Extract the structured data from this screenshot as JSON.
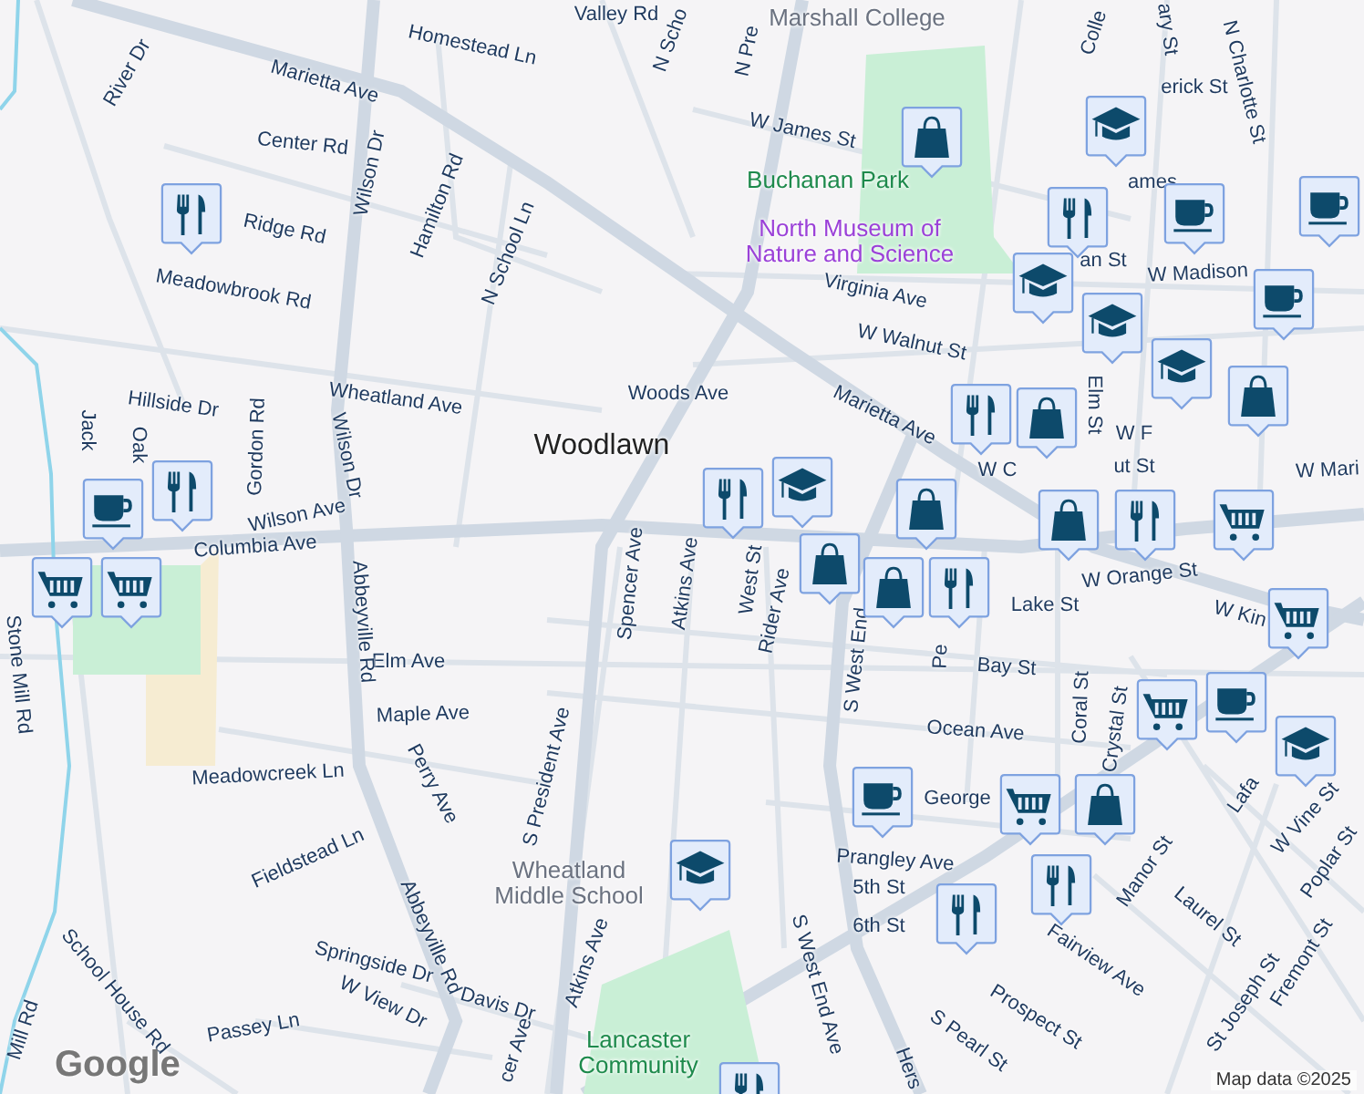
{
  "map": {
    "places": [
      {
        "text": "Woodlawn",
        "kind": "neighborhood"
      },
      {
        "text": "Buchanan Park",
        "kind": "park"
      },
      {
        "text": "North Museum of Nature and Science",
        "kind": "museum"
      },
      {
        "text": "Wheatland Middle School",
        "kind": "school"
      },
      {
        "text": "Marshall College",
        "kind": "school"
      },
      {
        "text": "Lancaster Community",
        "kind": "park"
      }
    ],
    "streets": [
      "Marietta Ave",
      "Homestead Ln",
      "Valley Rd",
      "N Scho",
      "River Dr",
      "Center Rd",
      "Wilson Dr",
      "Hamilton Rd",
      "Ridge Rd",
      "Meadowbrook Rd",
      "N School Ln",
      "Wheatland Ave",
      "Woods Ave",
      "Hillside Dr",
      "Gordon Rd",
      "Wilson Dr",
      "Jack",
      "Oak",
      "Wilson Ave",
      "Columbia Ave",
      "N Pre",
      "Colle",
      "ary St",
      "N Charlotte St",
      "erick St",
      "W James St",
      "ames",
      "Virginia Ave",
      "an St",
      "W Madison",
      "W Walnut St",
      "Marietta Ave",
      "Elm St",
      "W F",
      "W C",
      "ut St",
      "W Mari",
      "Rider Ave",
      "West St",
      "Atkins Ave",
      "Spencer Ave",
      "W Orange St",
      "Pe",
      "Lake St",
      "W Kin",
      "S West End",
      "Bay St",
      "Ocean Ave",
      "Coral St",
      "Crystal St",
      "George",
      "Prangley Ave",
      "5th St",
      "6th St",
      "S West End Ave",
      "Manor St",
      "Fairview Ave",
      "Laurel St",
      "St Joseph St",
      "W Vine St",
      "Poplar St",
      "Fremont St",
      "Prospect St",
      "S Pearl St",
      "Hers",
      "Lafa",
      "Stone Mill Rd",
      "Elm Ave",
      "Maple Ave",
      "Abbeyville Rd",
      "Meadowcreek Ln",
      "Perry Ave",
      "S President Ave",
      "Fieldstead Ln",
      "Abbeyville Rd",
      "Springside Dr",
      "W View Dr",
      "Davis Dr",
      "Atkins Ave",
      "School House Rd",
      "Mill Rd",
      "Passey Ln",
      "cer Ave"
    ],
    "pins": [
      {
        "kind": "restaurant"
      },
      {
        "kind": "restaurant"
      },
      {
        "kind": "restaurant"
      },
      {
        "kind": "restaurant"
      },
      {
        "kind": "restaurant"
      },
      {
        "kind": "restaurant"
      },
      {
        "kind": "restaurant"
      },
      {
        "kind": "restaurant"
      },
      {
        "kind": "restaurant"
      },
      {
        "kind": "restaurant"
      },
      {
        "kind": "cafe"
      },
      {
        "kind": "cafe"
      },
      {
        "kind": "cafe"
      },
      {
        "kind": "cafe"
      },
      {
        "kind": "cafe"
      },
      {
        "kind": "cafe"
      },
      {
        "kind": "grocery"
      },
      {
        "kind": "grocery"
      },
      {
        "kind": "grocery"
      },
      {
        "kind": "grocery"
      },
      {
        "kind": "grocery"
      },
      {
        "kind": "grocery"
      },
      {
        "kind": "shopping"
      },
      {
        "kind": "shopping"
      },
      {
        "kind": "shopping"
      },
      {
        "kind": "shopping"
      },
      {
        "kind": "shopping"
      },
      {
        "kind": "shopping"
      },
      {
        "kind": "shopping"
      },
      {
        "kind": "shopping"
      },
      {
        "kind": "school"
      },
      {
        "kind": "school"
      },
      {
        "kind": "school"
      },
      {
        "kind": "school"
      },
      {
        "kind": "school"
      },
      {
        "kind": "school"
      },
      {
        "kind": "school"
      }
    ],
    "attribution": {
      "logo": "Google",
      "text": "Map data ©2025"
    }
  }
}
